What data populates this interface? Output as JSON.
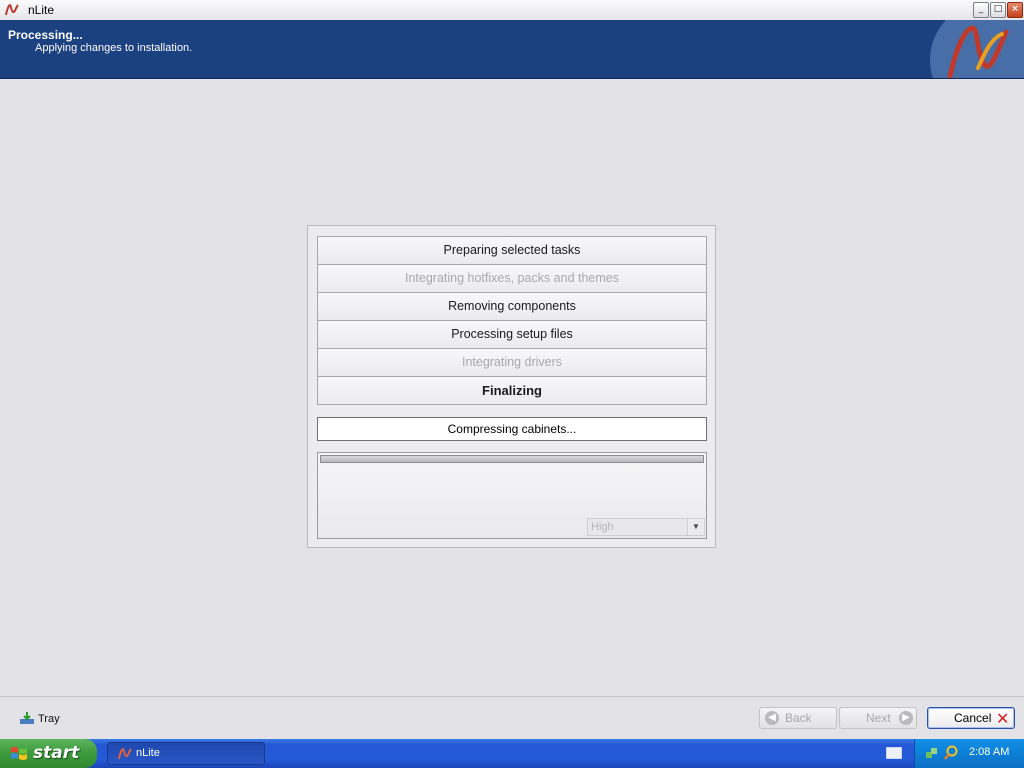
{
  "window": {
    "title": "nLite",
    "controls": {
      "minimize": "_",
      "maximize": "□",
      "close": "×"
    }
  },
  "banner": {
    "title": "Processing...",
    "subtitle": "Applying changes to installation.",
    "logo_icon": "nlite-logo"
  },
  "tasks": [
    {
      "label": "Preparing selected tasks",
      "state": "done"
    },
    {
      "label": "Integrating hotfixes, packs and themes",
      "state": "skipped"
    },
    {
      "label": "Removing components",
      "state": "done"
    },
    {
      "label": "Processing setup files",
      "state": "done"
    },
    {
      "label": "Integrating drivers",
      "state": "skipped"
    },
    {
      "label": "Finalizing",
      "state": "active"
    }
  ],
  "status": {
    "text": "Compressing cabinets..."
  },
  "progress": {
    "fraction": 1.0
  },
  "priority": {
    "selected": "High"
  },
  "bottom": {
    "tray_label": "Tray",
    "back_label": "Back",
    "next_label": "Next",
    "cancel_label": "Cancel"
  },
  "taskbar": {
    "start_label": "start",
    "task_item": "nLite",
    "clock": "2:08 AM"
  },
  "colors": {
    "banner": "#1c4181",
    "cancel_x": "#d41f1f",
    "taskbar": "#245ad8"
  }
}
